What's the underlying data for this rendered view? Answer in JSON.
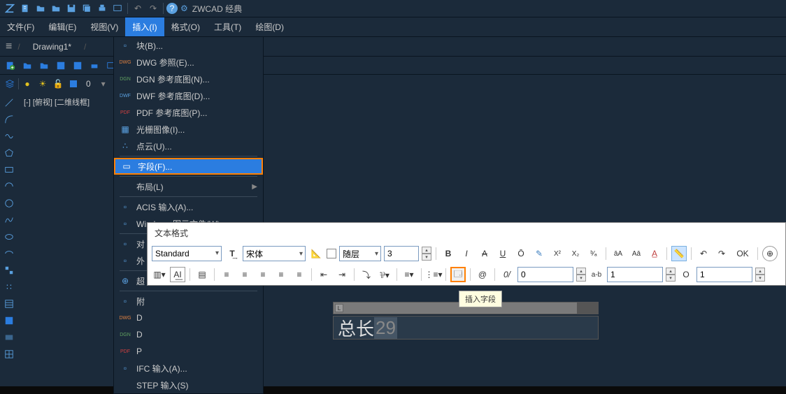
{
  "app": {
    "title": "ZWCAD 经典"
  },
  "menubar": [
    "文件(F)",
    "编辑(E)",
    "视图(V)",
    "插入(I)",
    "格式(O)",
    "工具(T)",
    "绘图(D)"
  ],
  "menubar_active": 3,
  "tab": "Drawing1*",
  "viewport_label": "[-] [俯视] [二维线框]",
  "insert_menu": [
    {
      "icon": "block",
      "label": "块(B)..."
    },
    {
      "icon": "dwg",
      "label": "DWG 参照(E)..."
    },
    {
      "icon": "dgn",
      "label": "DGN 参考底图(N)..."
    },
    {
      "icon": "dwf",
      "label": "DWF 参考底图(D)..."
    },
    {
      "icon": "pdf",
      "label": "PDF 参考底图(P)..."
    },
    {
      "icon": "raster",
      "label": "光栅图像(I)..."
    },
    {
      "icon": "cloud",
      "label": "点云(U)..."
    },
    {
      "sep": true
    },
    {
      "icon": "field",
      "label": "字段(F)...",
      "highlighted": true
    },
    {
      "sep": true
    },
    {
      "icon": "layout",
      "label": "布局(L)",
      "arrow": true
    },
    {
      "sep": true
    },
    {
      "icon": "acis",
      "label": "ACIS 输入(A)..."
    },
    {
      "icon": "win",
      "label": "Windows 图元文件(W)..."
    },
    {
      "sep": true
    },
    {
      "icon": "obj",
      "label": "对",
      "cut": true
    },
    {
      "icon": "ext",
      "label": "外",
      "cut": true
    },
    {
      "sep": true
    },
    {
      "icon": "grp",
      "label": "超",
      "cut": true
    },
    {
      "sep": true
    },
    {
      "icon": "att",
      "label": "附",
      "cut": true
    },
    {
      "icon": "dwg2",
      "label": "D",
      "cut": true
    },
    {
      "icon": "dgn2",
      "label": "D",
      "cut": true
    },
    {
      "icon": "pdf2",
      "label": "P",
      "cut": true
    },
    {
      "icon": "ifc",
      "label": "IFC 输入(A)..."
    },
    {
      "icon": "step",
      "label": "STEP 输入(S)"
    }
  ],
  "text_editor": {
    "title": "文本格式",
    "style": "Standard",
    "font": "宋体",
    "layer": "随层",
    "size": "3",
    "bold": "B",
    "italic": "I",
    "strike": "A",
    "underline": "U",
    "overline": "Ō",
    "ok": "OK",
    "oblique": "0",
    "tracking": "1",
    "width": "1",
    "ab": "a-b",
    "at": "@",
    "slash": "0/",
    "circle": "O"
  },
  "tooltip": "插入字段",
  "canvas_text": {
    "prefix": "总长",
    "num": "29"
  }
}
